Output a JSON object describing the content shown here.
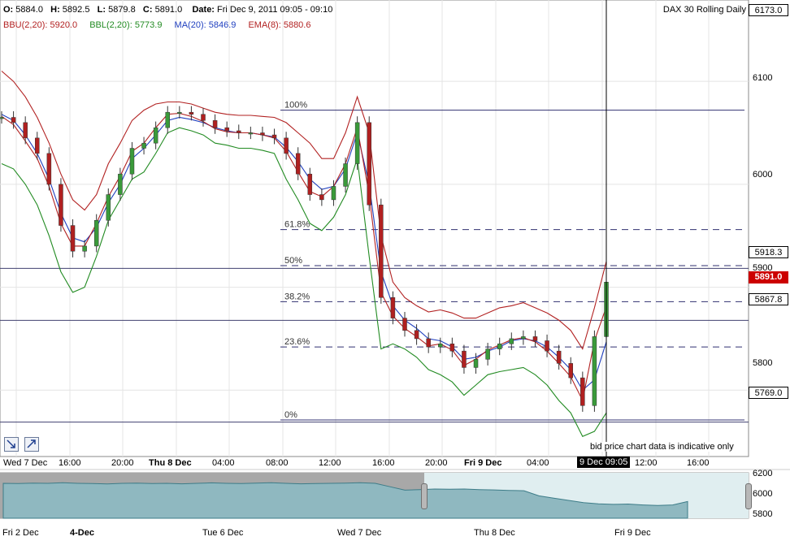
{
  "header": {
    "open_label": "O:",
    "open": "5884.0",
    "high_label": "H:",
    "high": "5892.5",
    "low_label": "L:",
    "low": "5879.8",
    "close_label": "C:",
    "close": "5891.0",
    "date_label": "Date:",
    "date": "Fri Dec 9, 2011 09:05 - 09:10",
    "instrument": "DAX 30  Rolling Daily"
  },
  "indicators": [
    {
      "text": "BBU(2,20): 5920.0",
      "color": "#b22222"
    },
    {
      "text": "BBL(2,20): 5773.9",
      "color": "#228b22"
    },
    {
      "text": "MA(20): 5846.9",
      "color": "#1f3fbf"
    },
    {
      "text": "EMA(8): 5880.6",
      "color": "#b22222"
    }
  ],
  "price_badges": {
    "top": "6173.0",
    "line_a": "5918.3",
    "current": "5891.0",
    "line_b": "5867.8",
    "line_c": "5769.0"
  },
  "cursor_label": "9 Dec 09:05",
  "disclaimer": "bid price chart data is indicative only",
  "x_labels": [
    {
      "text": "Wed 7 Dec",
      "bold": false
    },
    {
      "text": "16:00",
      "bold": false
    },
    {
      "text": "20:00",
      "bold": false
    },
    {
      "text": "Thu 8 Dec",
      "bold": true
    },
    {
      "text": "04:00",
      "bold": false
    },
    {
      "text": "08:00",
      "bold": false
    },
    {
      "text": "12:00",
      "bold": false
    },
    {
      "text": "16:00",
      "bold": false
    },
    {
      "text": "20:00",
      "bold": false
    },
    {
      "text": "Fri 9 Dec",
      "bold": true
    },
    {
      "text": "04:00",
      "bold": false
    },
    {
      "text": "12:00",
      "bold": false
    },
    {
      "text": "16:00",
      "bold": false
    }
  ],
  "nav_labels": [
    {
      "text": "Fri 2 Dec",
      "bold": false
    },
    {
      "text": "4-Dec",
      "bold": true
    },
    {
      "text": "Tue 6 Dec",
      "bold": false
    },
    {
      "text": "Wed 7 Dec",
      "bold": false
    },
    {
      "text": "Thu 8 Dec",
      "bold": false
    },
    {
      "text": "Fri 9 Dec",
      "bold": false
    }
  ],
  "nav_y_labels": [
    "6200",
    "6000",
    "5800"
  ],
  "chart_data": {
    "type": "line",
    "title": "DAX 30  Rolling Daily",
    "xlabel": "",
    "ylabel": "",
    "y_ticks": [
      6100,
      6000,
      5900,
      5800
    ],
    "ylim": [
      5745,
      6173
    ],
    "grid": true,
    "fib_levels": [
      {
        "label": "100%",
        "value": 6072
      },
      {
        "label": "61.8%",
        "value": 5956
      },
      {
        "label": "50%",
        "value": 5921
      },
      {
        "label": "38.2%",
        "value": 5886
      },
      {
        "label": "23.6%",
        "value": 5842
      },
      {
        "label": "0%",
        "value": 5771
      }
    ],
    "horizontal_lines": [
      5918.3,
      5867.8,
      5769.0
    ],
    "x_index_labels": [
      "Wed 7 Dec 12:00",
      "16:00",
      "20:00",
      "Thu 8 Dec 00:00",
      "04:00",
      "08:00",
      "12:00",
      "16:00",
      "20:00",
      "Fri 9 Dec 00:00",
      "04:00",
      "09:05"
    ],
    "series": [
      {
        "name": "Price",
        "color": "#8b0000",
        "values": [
          6065,
          6060,
          6045,
          6030,
          6000,
          5960,
          5935,
          5940,
          5965,
          5990,
          6010,
          6035,
          6040,
          6055,
          6070,
          6070,
          6068,
          6062,
          6055,
          6052,
          6050,
          6050,
          6048,
          6045,
          6030,
          6010,
          5990,
          5985,
          5998,
          6020,
          6060,
          5980,
          5890,
          5870,
          5858,
          5850,
          5842,
          5845,
          5838,
          5822,
          5830,
          5840,
          5845,
          5850,
          5852,
          5848,
          5838,
          5826,
          5812,
          5785,
          5852,
          5905
        ]
      },
      {
        "name": "BBU(2,20)",
        "color": "#b22222",
        "values": [
          6110,
          6100,
          6085,
          6065,
          6040,
          6010,
          5985,
          5975,
          5990,
          6020,
          6040,
          6062,
          6072,
          6078,
          6080,
          6080,
          6078,
          6074,
          6070,
          6068,
          6067,
          6067,
          6066,
          6065,
          6060,
          6050,
          6040,
          6025,
          6025,
          6050,
          6085,
          6050,
          5950,
          5905,
          5890,
          5882,
          5876,
          5878,
          5875,
          5870,
          5870,
          5875,
          5880,
          5882,
          5885,
          5880,
          5875,
          5868,
          5858,
          5840,
          5880,
          5925
        ]
      },
      {
        "name": "BBL(2,20)",
        "color": "#228b22",
        "values": [
          6020,
          6015,
          6000,
          5980,
          5950,
          5915,
          5895,
          5900,
          5930,
          5965,
          5985,
          6005,
          6012,
          6030,
          6050,
          6055,
          6052,
          6048,
          6040,
          6038,
          6035,
          6035,
          6033,
          6030,
          6005,
          5985,
          5962,
          5955,
          5968,
          5990,
          6025,
          5930,
          5840,
          5845,
          5840,
          5832,
          5820,
          5815,
          5808,
          5795,
          5805,
          5815,
          5818,
          5820,
          5822,
          5815,
          5805,
          5790,
          5778,
          5755,
          5760,
          5778
        ]
      },
      {
        "name": "MA(20)",
        "color": "#1f3fbf",
        "values": [
          6068,
          6062,
          6048,
          6030,
          6005,
          5972,
          5948,
          5944,
          5958,
          5982,
          6000,
          6025,
          6035,
          6048,
          6062,
          6065,
          6063,
          6060,
          6055,
          6052,
          6050,
          6050,
          6048,
          6046,
          6036,
          6022,
          6005,
          5995,
          5998,
          6015,
          6050,
          6000,
          5915,
          5882,
          5868,
          5860,
          5850,
          5848,
          5842,
          5830,
          5832,
          5838,
          5842,
          5848,
          5850,
          5848,
          5842,
          5832,
          5820,
          5800,
          5810,
          5847
        ]
      },
      {
        "name": "EMA(8)",
        "color": "#b22222",
        "values": [
          6066,
          6058,
          6042,
          6025,
          5998,
          5962,
          5940,
          5940,
          5962,
          5988,
          6008,
          6032,
          6040,
          6055,
          6068,
          6069,
          6066,
          6061,
          6054,
          6051,
          6050,
          6050,
          6048,
          6045,
          6032,
          6012,
          5993,
          5988,
          5998,
          6020,
          6055,
          5990,
          5895,
          5872,
          5860,
          5852,
          5843,
          5845,
          5839,
          5824,
          5830,
          5839,
          5844,
          5849,
          5851,
          5847,
          5838,
          5826,
          5813,
          5790,
          5848,
          5881
        ]
      }
    ]
  }
}
